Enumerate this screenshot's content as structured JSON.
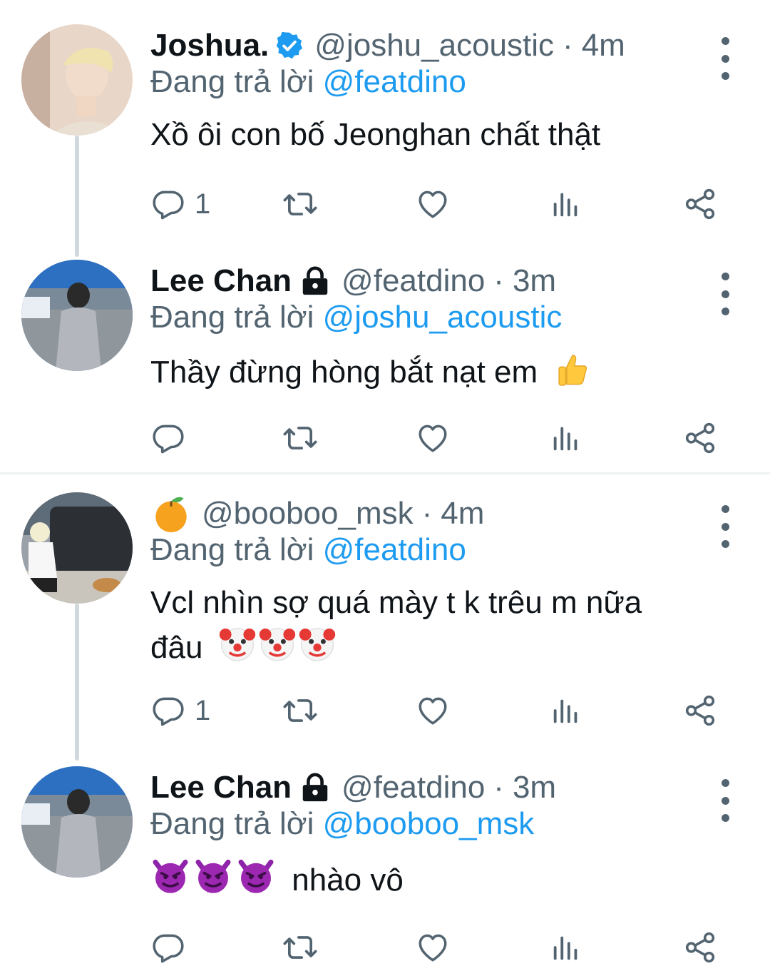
{
  "tweets": [
    {
      "name": "Joshua.",
      "verified": true,
      "handle": "@joshu_acoustic",
      "sep": "·",
      "time": "4m",
      "reply_prefix": "Đang trả lời",
      "reply_to": "@featdino",
      "text": "Xồ ôi con bố Jeonghan chất thật",
      "reply_count": "1"
    },
    {
      "name": "Lee Chan",
      "locked": true,
      "handle": "@featdino",
      "sep": "·",
      "time": "3m",
      "reply_prefix": "Đang trả lời",
      "reply_to": "@joshu_acoustic",
      "text": "Thầy đừng hòng bắt nạt em",
      "text_emoji": "thumbs-up",
      "reply_count": ""
    },
    {
      "name_emoji": "tangerine",
      "handle": "@booboo_msk",
      "sep": "·",
      "time": "4m",
      "reply_prefix": "Đang trả lời",
      "reply_to": "@featdino",
      "text_line1": "Vcl nhìn sợ quá mày t k trêu m nữa",
      "text_line2": "đâu",
      "text_emoji": "clown-face x3",
      "reply_count": "1"
    },
    {
      "name": "Lee Chan",
      "locked": true,
      "handle": "@featdino",
      "sep": "·",
      "time": "3m",
      "reply_prefix": "Đang trả lời",
      "reply_to": "@booboo_msk",
      "text_emoji": "smiling-imp x3",
      "text": "nhào vô",
      "reply_count": ""
    }
  ],
  "icons": {
    "reply": "reply-icon",
    "retweet": "retweet-icon",
    "like": "heart-icon",
    "views": "analytics-icon",
    "share": "share-icon",
    "more": "more-icon"
  },
  "colors": {
    "text": "#0f1419",
    "secondary": "#536471",
    "mention": "#1d9bf0",
    "thread_line": "#cfd9de",
    "divider": "#eff3f4"
  }
}
